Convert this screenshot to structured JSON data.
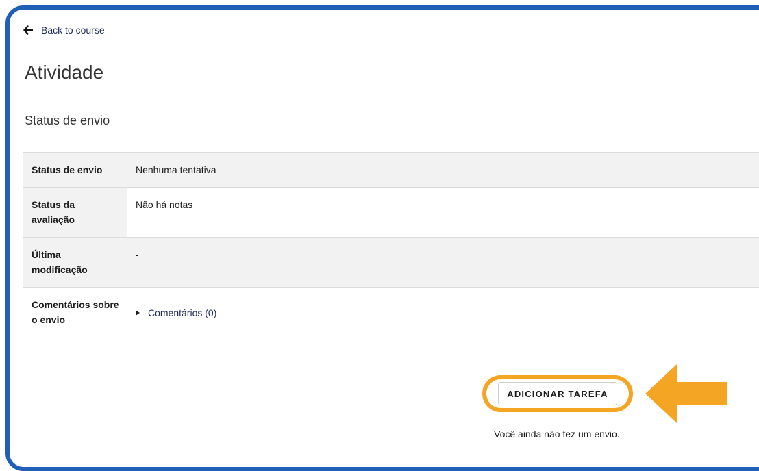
{
  "nav": {
    "back_label": "Back to course"
  },
  "page": {
    "title": "Atividade",
    "section_title": "Status de envio"
  },
  "status_table": {
    "rows": [
      {
        "label": "Status de envio",
        "value": "Nenhuma tentativa"
      },
      {
        "label": "Status da avaliação",
        "value": "Não há notas"
      },
      {
        "label": "Última modificação",
        "value": "-"
      },
      {
        "label": "Comentários sobre o envio",
        "value": "Comentários (0)"
      }
    ]
  },
  "actions": {
    "add_submission_label": "ADICIONAR TAREFA",
    "no_submission_text": "Você ainda não fez um envio."
  },
  "colors": {
    "frame_border": "#1f5fb5",
    "highlight": "#f5a524",
    "link": "#1d2a5c",
    "row_shade": "#f2f2f2"
  },
  "icons": {
    "back": "arrow-left-icon",
    "expand": "caret-right-icon",
    "pointer": "arrow-left-big-icon"
  }
}
